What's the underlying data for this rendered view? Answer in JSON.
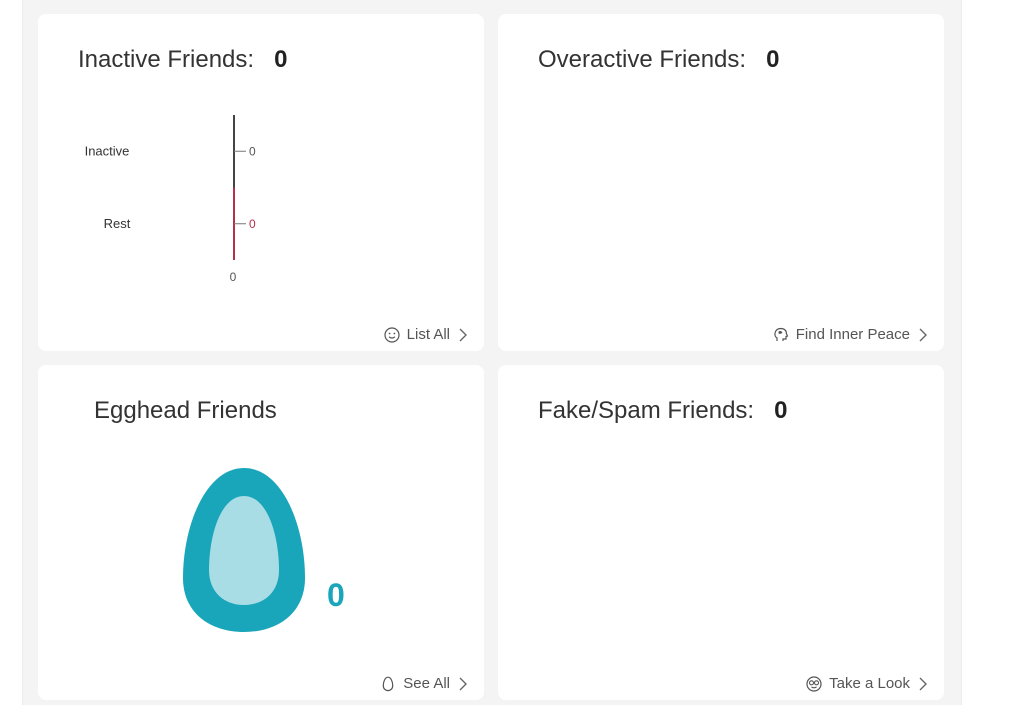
{
  "cards": {
    "inactive": {
      "title": "Inactive Friends:",
      "count": "0",
      "footer_label": "List All"
    },
    "overactive": {
      "title": "Overactive Friends:",
      "count": "0",
      "footer_label": "Find Inner Peace"
    },
    "egghead": {
      "title": "Egghead Friends",
      "count": "0",
      "footer_label": "See All"
    },
    "fake": {
      "title": "Fake/Spam Friends:",
      "count": "0",
      "footer_label": "Take a Look"
    }
  },
  "colors": {
    "accent": "#1aa6ba",
    "egg_inner": "#a8dde6",
    "rest_bar": "#b5304b"
  },
  "icons": {
    "inactive_footer": "smiley-face-icon",
    "overactive_footer": "head-profile-icon",
    "egghead_footer": "egg-outline-icon",
    "fake_footer": "glasses-face-icon"
  },
  "chart_data": {
    "type": "bar",
    "orientation": "horizontal",
    "categories": [
      "Inactive",
      "Rest"
    ],
    "values": [
      0,
      0
    ],
    "value_labels": [
      "0",
      "0"
    ],
    "xlim": [
      0,
      0
    ],
    "x_tick_labels": [
      "0"
    ],
    "grid": false
  }
}
